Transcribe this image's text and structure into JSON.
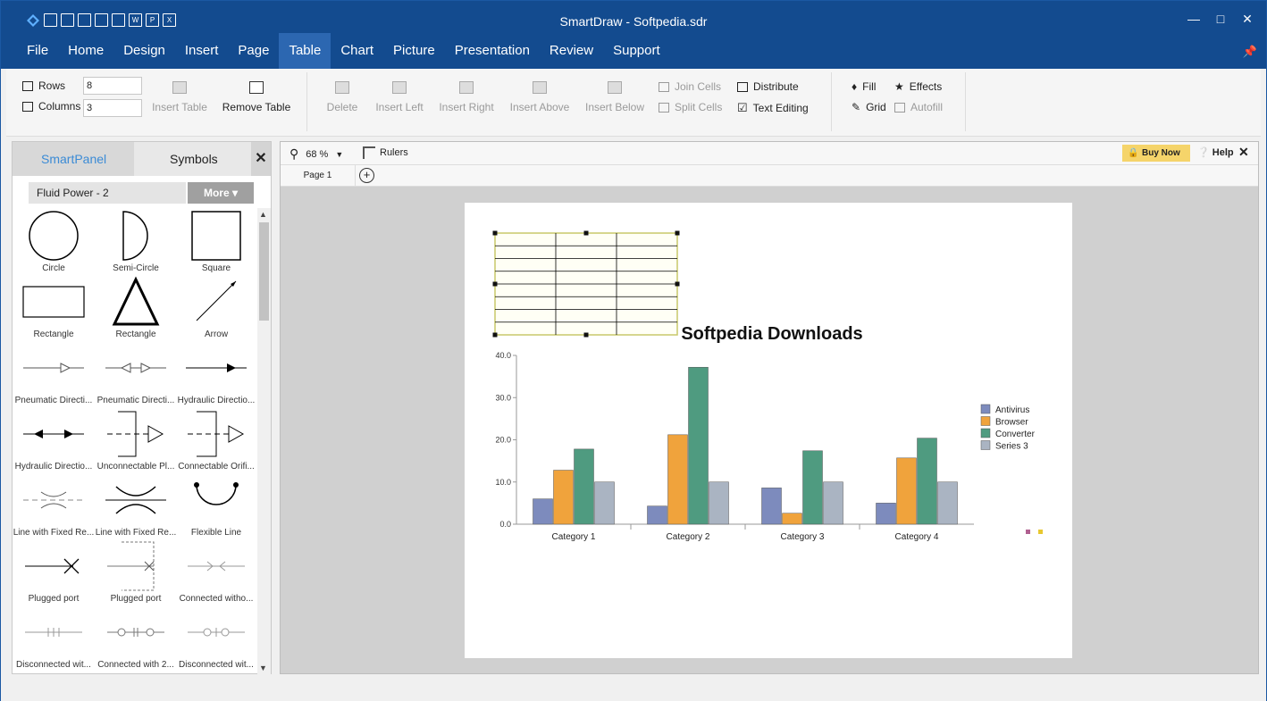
{
  "app": {
    "title": "SmartDraw - Softpedia.sdr"
  },
  "menu": {
    "items": [
      "File",
      "Home",
      "Design",
      "Insert",
      "Page",
      "Table",
      "Chart",
      "Picture",
      "Presentation",
      "Review",
      "Support"
    ],
    "active": "Table"
  },
  "ribbon": {
    "rows_label": "Rows",
    "rows_value": "8",
    "columns_label": "Columns",
    "columns_value": "3",
    "insert_table": "Insert Table",
    "remove_table": "Remove Table",
    "delete": "Delete",
    "insert_left": "Insert Left",
    "insert_right": "Insert Right",
    "insert_above": "Insert Above",
    "insert_below": "Insert Below",
    "join_cells": "Join Cells",
    "split_cells": "Split Cells",
    "distribute": "Distribute",
    "text_editing": "Text Editing",
    "fill": "Fill",
    "grid": "Grid",
    "effects": "Effects",
    "autofill": "Autofill"
  },
  "panel": {
    "tab_smart": "SmartPanel",
    "tab_symbols": "Symbols",
    "library": "Fluid Power - 2",
    "more": "More",
    "shapes": [
      {
        "label": "Circle",
        "icon": "circle-shape"
      },
      {
        "label": "Semi-Circle",
        "icon": "semicircle-shape"
      },
      {
        "label": "Square",
        "icon": "square-shape"
      },
      {
        "label": "Rectangle",
        "icon": "rectangle-shape"
      },
      {
        "label": "Rectangle",
        "icon": "triangle-shape"
      },
      {
        "label": "Arrow",
        "icon": "arrow-shape"
      },
      {
        "label": "Pneumatic Directi...",
        "icon": "pneumatic-direction-shape"
      },
      {
        "label": "Pneumatic Directi...",
        "icon": "pneumatic-bidirection-shape"
      },
      {
        "label": "Hydraulic Directio...",
        "icon": "hydraulic-direction-shape"
      },
      {
        "label": "Hydraulic Directio...",
        "icon": "hydraulic-bidirection-shape"
      },
      {
        "label": "Unconnectable Pl...",
        "icon": "unconnectable-plug-shape"
      },
      {
        "label": "Connectable Orifi...",
        "icon": "connectable-orifice-shape"
      },
      {
        "label": "Line with Fixed Re...",
        "icon": "line-fixed-restriction-shape"
      },
      {
        "label": "Line with Fixed Re...",
        "icon": "line-fixed-restriction-2-shape"
      },
      {
        "label": "Flexible Line",
        "icon": "flexible-line-shape"
      },
      {
        "label": "Plugged port",
        "icon": "plugged-port-shape"
      },
      {
        "label": "Plugged port",
        "icon": "plugged-port-2-shape"
      },
      {
        "label": "Connected witho...",
        "icon": "connected-without-shape"
      },
      {
        "label": "Disconnected wit...",
        "icon": "disconnected-with-shape"
      },
      {
        "label": "Connected with 2...",
        "icon": "connected-with-2-shape"
      },
      {
        "label": "Disconnected wit...",
        "icon": "disconnected-with-2-shape"
      }
    ]
  },
  "canvas": {
    "zoom": "68 %",
    "rulers": "Rulers",
    "buy_now": "Buy Now",
    "help": "Help",
    "page_tab": "Page 1",
    "table_rows": 8,
    "table_cols": 3
  },
  "chart_data": {
    "type": "bar",
    "title": "Softpedia Downloads",
    "categories": [
      "Category 1",
      "Category 2",
      "Category 3",
      "Category 4"
    ],
    "series": [
      {
        "name": "Antivirus",
        "values": [
          6.0,
          4.3,
          8.6,
          5.0
        ],
        "color": "#7d8bbd"
      },
      {
        "name": "Browser",
        "values": [
          12.8,
          21.2,
          2.6,
          15.7
        ],
        "color": "#f0a33c"
      },
      {
        "name": "Converter",
        "values": [
          17.8,
          37.2,
          17.4,
          20.4
        ],
        "color": "#4f9b80"
      },
      {
        "name": "Series 3",
        "values": [
          10.0,
          10.0,
          10.0,
          10.0
        ],
        "color": "#aab4c2"
      }
    ],
    "ylim": [
      0,
      40
    ],
    "yticks": [
      "0.0",
      "10.0",
      "20.0",
      "30.0",
      "40.0"
    ],
    "legend": "right"
  }
}
